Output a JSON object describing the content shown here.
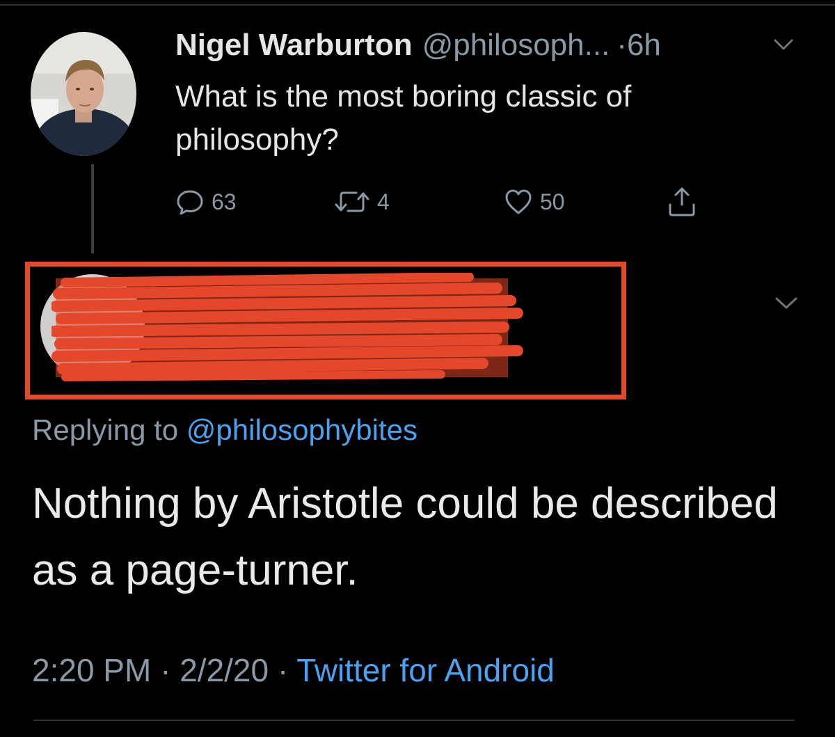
{
  "parent_tweet": {
    "author_name": "Nigel Warburton",
    "author_handle": "@philosoph...",
    "separator": "·",
    "time_ago": "6h",
    "text": "What is the most boring classic of philosophy?",
    "actions": {
      "reply_count": "63",
      "retweet_count": "4",
      "like_count": "50"
    },
    "icons": {
      "reply": "reply-icon",
      "retweet": "retweet-icon",
      "like": "heart-icon",
      "share": "share-icon",
      "menu": "chevron-down-icon"
    }
  },
  "reply_tweet": {
    "replying_prefix": "Replying to ",
    "replying_handle": "@philosophybites",
    "text": "Nothing by Aristotle could be described as a page-turner.",
    "time": "2:20 PM",
    "sep1": " · ",
    "date": "2/2/20",
    "sep2": " · ",
    "client": "Twitter for Android"
  },
  "colors": {
    "background": "#000000",
    "text_primary": "#e6e6e6",
    "text_secondary": "#8b98a5",
    "link": "#4aa3f0",
    "redaction": "#e24a2a"
  }
}
